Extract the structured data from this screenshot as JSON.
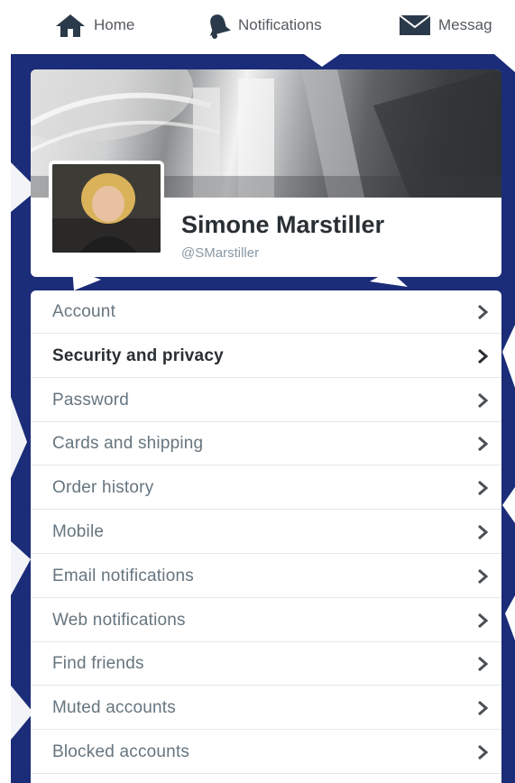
{
  "nav": {
    "home": "Home",
    "notifications": "Notifications",
    "messages": "Messag"
  },
  "profile": {
    "name": "Simone Marstiller",
    "handle": "@SMarstiller"
  },
  "menu": {
    "items": [
      {
        "label": "Account",
        "active": false
      },
      {
        "label": "Security and privacy",
        "active": true
      },
      {
        "label": "Password",
        "active": false
      },
      {
        "label": "Cards and shipping",
        "active": false
      },
      {
        "label": "Order history",
        "active": false
      },
      {
        "label": "Mobile",
        "active": false
      },
      {
        "label": "Email notifications",
        "active": false
      },
      {
        "label": "Web notifications",
        "active": false
      },
      {
        "label": "Find friends",
        "active": false
      },
      {
        "label": "Muted accounts",
        "active": false
      },
      {
        "label": "Blocked accounts",
        "active": false
      }
    ]
  },
  "colors": {
    "background": "#1b2c78",
    "nav_icon": "#2b3a4a",
    "text_muted": "#66757f"
  }
}
